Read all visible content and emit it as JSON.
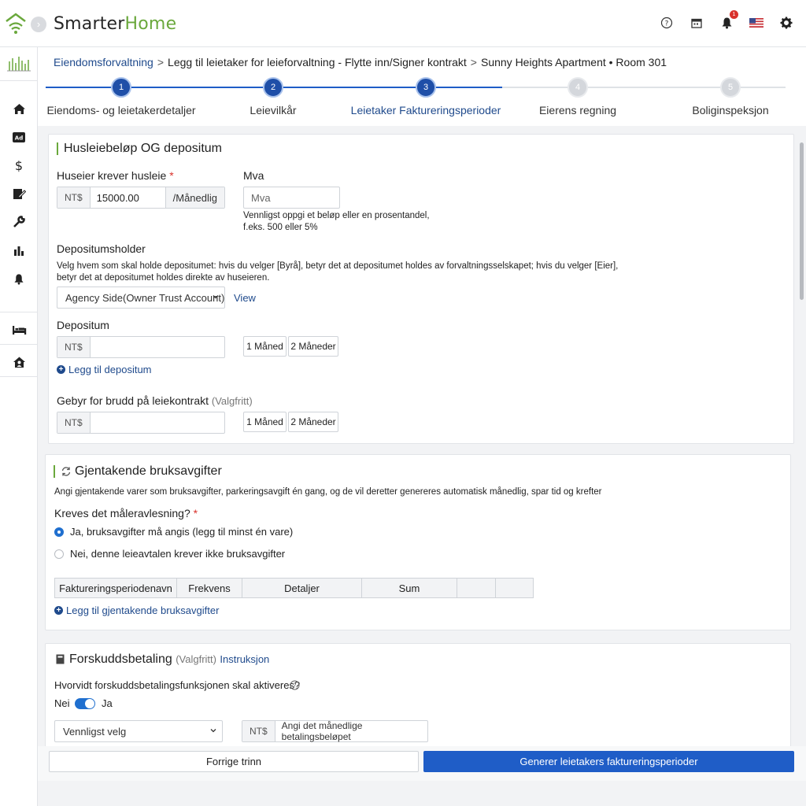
{
  "app": {
    "brand_part1": "Smarter",
    "brand_part2": "Home"
  },
  "colors": {
    "brand_green": "#6aa83c",
    "primary_blue": "#1f5dc7",
    "link_blue": "#1f4a8c",
    "required_red": "#d9322c"
  },
  "topbar": {
    "icons": [
      "help-icon",
      "calendar-icon",
      "bell-icon",
      "us-flag-icon",
      "gear-icon"
    ],
    "notification_count": "1"
  },
  "sidebar": {
    "items": [
      "home-icon",
      "ad-icon",
      "dollar-icon",
      "edit-document-icon",
      "wrench-icon",
      "bar-chart-icon",
      "bell-icon",
      "bed-icon",
      "house-person-icon"
    ]
  },
  "breadcrumb": {
    "items": [
      "Eiendomsforvaltning",
      "Legg til leietaker for leieforvaltning - Flytte inn/Signer kontrakt",
      "Sunny Heights Apartment • Room 301"
    ],
    "separator": ">"
  },
  "stepper": {
    "steps": [
      {
        "number": "1",
        "label": "Eiendoms- og leietakerdetaljer",
        "state": "done"
      },
      {
        "number": "2",
        "label": "Leievilkår",
        "state": "done"
      },
      {
        "number": "3",
        "label": "Leietaker Faktureringsperioder",
        "state": "active"
      },
      {
        "number": "4",
        "label": "Eierens regning",
        "state": "todo"
      },
      {
        "number": "5",
        "label": "Boliginspeksjon",
        "state": "todo"
      }
    ]
  },
  "rent_section": {
    "title": "Husleiebeløp OG depositum",
    "rent_label": "Huseier krever husleie",
    "required_mark": "*",
    "currency": "NT$",
    "rent_value": "15000.00",
    "rent_period": "/Månedlig",
    "vat_label": "Mva",
    "vat_placeholder": "Mva",
    "vat_hint": "Vennligst oppgi et beløp eller en prosentandel, f.eks. 500 eller 5%",
    "holder_label": "Depositumsholder",
    "holder_hint": "Velg hvem som skal holde depositumet: hvis du velger [Byrå], betyr det at depositumet holdes av forvaltningsselskapet; hvis du velger [Eier], betyr det at depositumet holdes direkte av huseieren.",
    "holder_selected": "Agency Side(Owner Trust Account)",
    "view_link": "View",
    "deposit_label": "Depositum",
    "one_month": "1 Måned",
    "two_months": "2 Måneder",
    "add_deposit": "Legg til depositum",
    "breach_label": "Gebyr for brudd på leiekontrakt",
    "optional": "(Valgfritt)"
  },
  "utility_section": {
    "title": "Gjentakende bruksavgifter",
    "description": "Angi gjentakende varer som bruksavgifter, parkeringsavgift én gang, og de vil deretter genereres automatisk månedlig, spar tid og krefter",
    "meter_question": "Kreves det måleravlesning?",
    "required_mark": "*",
    "option_yes": "Ja, bruksavgifter må angis (legg til minst én vare)",
    "option_no": "Nei, denne leieavtalen krever ikke bruksavgifter",
    "selected": "yes",
    "table_headers": [
      "Faktureringsperiodenavn",
      "Frekvens",
      "Detaljer",
      "Sum",
      "",
      ""
    ],
    "add_link": "Legg til gjentakende bruksavgifter"
  },
  "prepay_section": {
    "title": "Forskuddsbetaling",
    "optional": "(Valgfritt)",
    "instructions_link": "Instruksjon",
    "question": "Hvorvidt forskuddsbetalingsfunksjonen skal aktiveres?",
    "toggle_off_label": "Nei",
    "toggle_on_label": "Ja",
    "toggle_state": "on",
    "select_placeholder": "Vennligst velg",
    "currency": "NT$",
    "amount_placeholder": "Angi det månedlige betalingsbeløpet"
  },
  "footer": {
    "prev_button": "Forrige trinn",
    "generate_button": "Generer leietakers faktureringsperioder"
  }
}
